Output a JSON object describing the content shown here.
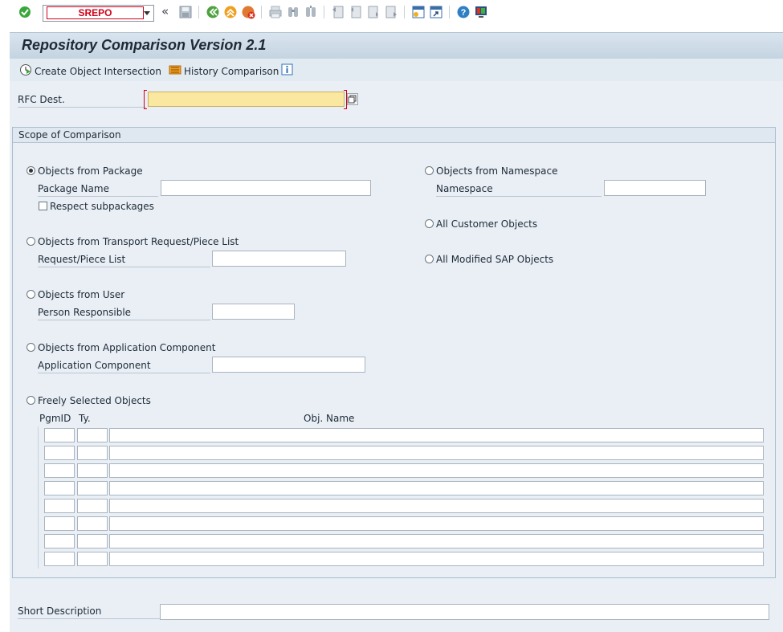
{
  "toolbar": {
    "command_field": "SREPO",
    "icons": [
      "enter-icon",
      "back-double-icon",
      "save-icon",
      "back-icon",
      "exit-icon",
      "cancel-icon",
      "print-icon",
      "find-icon",
      "find-next-icon",
      "first-page-icon",
      "previous-page-icon",
      "next-page-icon",
      "last-page-icon",
      "create-session-icon",
      "shortcut-icon",
      "help-icon",
      "customize-layout-icon"
    ]
  },
  "title": "Repository Comparison Version 2.1",
  "app_toolbar": {
    "create_intersection": "Create Object Intersection",
    "history_comparison": "History Comparison",
    "info_icon": "info-icon"
  },
  "rfc": {
    "label": "RFC Dest.",
    "value": ""
  },
  "scope": {
    "header": "Scope of Comparison",
    "package": {
      "radio": "Objects from Package",
      "field_label": "Package Name",
      "value": "",
      "subpackages": "Respect subpackages"
    },
    "transport": {
      "radio": "Objects from Transport Request/Piece List",
      "field_label": "Request/Piece List",
      "value": ""
    },
    "user": {
      "radio": "Objects from User",
      "field_label": "Person Responsible",
      "value": ""
    },
    "component": {
      "radio": "Objects from Application Component",
      "field_label": "Application Component",
      "value": ""
    },
    "free": {
      "radio": "Freely Selected Objects",
      "col_pgmid": "PgmID",
      "col_type": "Ty.",
      "col_name": "Obj. Name"
    },
    "namespace": {
      "radio": "Objects from Namespace",
      "field_label": "Namespace",
      "value": ""
    },
    "customer": {
      "radio": "All Customer Objects"
    },
    "modified": {
      "radio": "All Modified SAP Objects"
    },
    "selected": "package"
  },
  "short_description": {
    "label": "Short Description",
    "value": ""
  },
  "colors": {
    "accent_red": "#d0021b",
    "rfc_field": "#fbe8a0",
    "background": "#e9eff5"
  }
}
